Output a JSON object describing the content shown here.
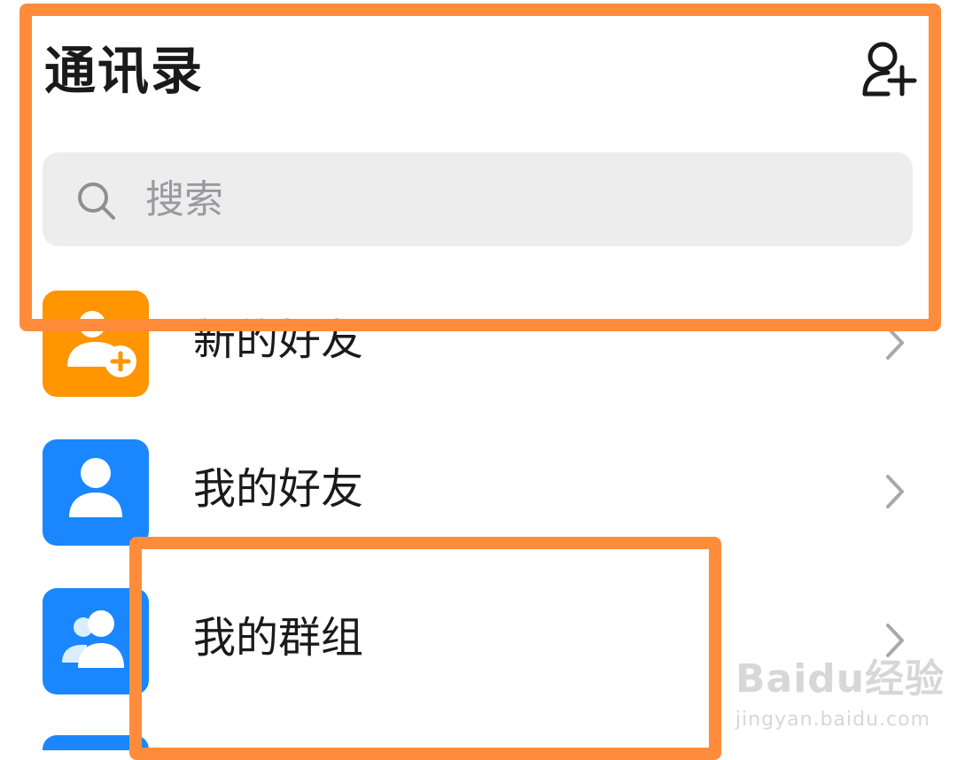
{
  "header": {
    "title": "通讯录",
    "add_icon": "add-contact-icon"
  },
  "search": {
    "placeholder": "搜索",
    "icon": "search-icon"
  },
  "items": [
    {
      "label": "新的好友",
      "icon": "new-friend-icon",
      "color": "#ff9500"
    },
    {
      "label": "我的好友",
      "icon": "friend-icon",
      "color": "#1a86ff"
    },
    {
      "label": "我的群组",
      "icon": "group-icon",
      "color": "#1a86ff"
    },
    {
      "icon_color": "#1a86ff"
    }
  ],
  "highlight_color": "#ff8c3a",
  "watermark": {
    "main": "Baidu经验",
    "sub": "jingyan.baidu.com"
  }
}
